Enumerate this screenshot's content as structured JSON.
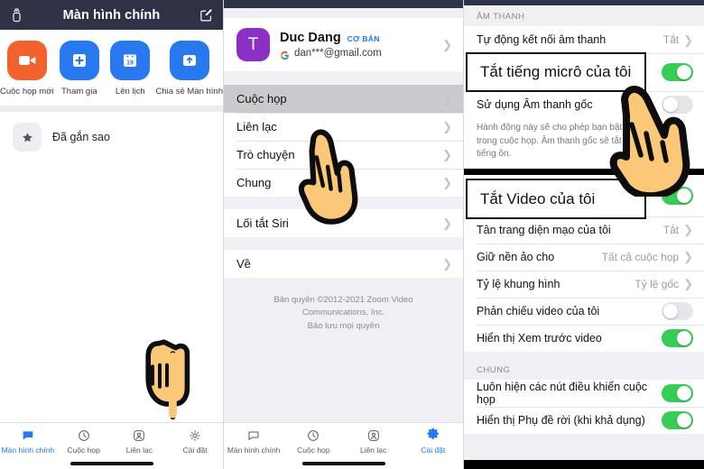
{
  "panel_home": {
    "header": {
      "title": "Màn hình chính",
      "cast_icon": "cast-icon",
      "edit_icon": "edit-compose-icon"
    },
    "actions": [
      {
        "label": "Cuộc họp mới",
        "icon": "video-camera-icon",
        "color": "#f3622c"
      },
      {
        "label": "Tham gia",
        "icon": "plus-icon",
        "color": "#2878f0"
      },
      {
        "label": "Lên lịch",
        "icon": "calendar-icon",
        "calendar_day": "19",
        "color": "#2878f0"
      },
      {
        "label": "Chia sẻ Màn hình",
        "icon": "share-screen-up-arrow-icon",
        "color": "#2878f0"
      }
    ],
    "starred": {
      "label": "Đã gắn sao",
      "icon": "star-icon"
    },
    "tabs": [
      {
        "label": "Màn hình chính",
        "icon": "chat-bubble-icon",
        "active": true
      },
      {
        "label": "Cuộc họp",
        "icon": "clock-icon",
        "active": false
      },
      {
        "label": "Liên lạc",
        "icon": "person-circle-icon",
        "active": false
      },
      {
        "label": "Cài đặt",
        "icon": "gear-icon",
        "active": false
      }
    ]
  },
  "panel_settings": {
    "account": {
      "avatar_initial": "T",
      "avatar_color": "#8c2fc4",
      "name": "Duc Dang",
      "badge": "CƠ BẢN",
      "email": "dan***@gmail.com",
      "provider_icon": "google-g-icon"
    },
    "menu_primary": [
      {
        "label": "Cuộc họp",
        "selected": true
      },
      {
        "label": "Liên lạc",
        "selected": false
      },
      {
        "label": "Trò chuyện",
        "selected": false
      },
      {
        "label": "Chung",
        "selected": false
      }
    ],
    "menu_siri": [
      {
        "label": "Lối tắt Siri",
        "selected": false
      }
    ],
    "menu_about": [
      {
        "label": "Về",
        "selected": false
      }
    ],
    "copyright_line1": "Bản quyền ©2012-2021 Zoom Video Communications, Inc.",
    "copyright_line2": "Bảo lưu mọi quyền",
    "tabs": [
      {
        "label": "Màn hình chính",
        "icon": "chat-bubble-icon",
        "active": false
      },
      {
        "label": "Cuộc họp",
        "icon": "clock-icon",
        "active": false
      },
      {
        "label": "Liên lạc",
        "icon": "person-circle-icon",
        "active": false
      },
      {
        "label": "Cài đặt",
        "icon": "gear-icon",
        "active": true
      }
    ]
  },
  "panel_meeting_settings": {
    "section_audio": "ÂM THANH",
    "rows_audio": [
      {
        "label": "Tự động kết nối âm thanh",
        "value": "Tắt",
        "control": "chevron"
      },
      {
        "label": "Tắt tiếng micrô của tôi",
        "control": "toggle",
        "state": "on"
      },
      {
        "label": "Sử dụng Âm thanh gốc",
        "control": "toggle",
        "state": "off"
      }
    ],
    "audio_description": "Hành động này sẽ cho phép bạn bật Âm thanh gốc trong cuộc họp. Âm thanh gốc sẽ tắt tính năng triệt tiếng ồn.",
    "rows_video": [
      {
        "label": "Tắt Video của tôi",
        "control": "toggle",
        "state": "on"
      },
      {
        "label": "Tân trang diện mạo của tôi",
        "value": "Tắt",
        "control": "chevron"
      },
      {
        "label": "Giữ nền ảo cho",
        "value": "Tất cả cuộc họp",
        "control": "chevron"
      },
      {
        "label": "Tỷ lệ khung hình",
        "value": "Tỷ lệ gốc",
        "control": "chevron"
      },
      {
        "label": "Phản chiếu video của tôi",
        "control": "toggle",
        "state": "off"
      },
      {
        "label": "Hiển thị Xem trước video",
        "control": "toggle",
        "state": "on"
      }
    ],
    "section_general": "CHUNG",
    "rows_general": [
      {
        "label": "Luôn hiện các nút điều khiển cuộc họp",
        "control": "toggle",
        "state": "on"
      },
      {
        "label": "Hiển thị Phụ đề rời (khi khả dụng)",
        "control": "toggle",
        "state": "on"
      }
    ]
  },
  "callouts": [
    {
      "text": "Tắt tiếng micrô của tôi"
    },
    {
      "text": "Tắt Video của tôi"
    }
  ],
  "cursors": [
    {
      "name": "hand-pointer-home"
    },
    {
      "name": "hand-pointer-meeting-menu"
    },
    {
      "name": "hand-pointer-mic-toggle"
    }
  ]
}
